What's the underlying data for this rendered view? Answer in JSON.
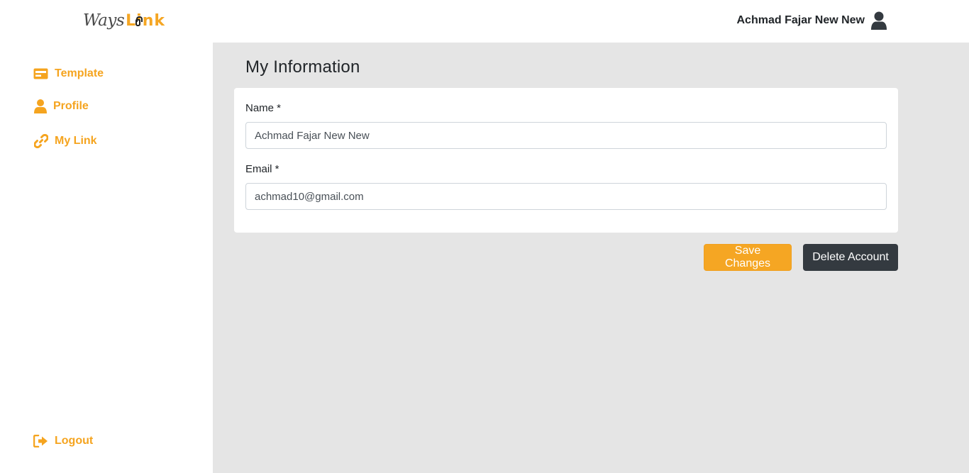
{
  "brand": {
    "part1": "Ways",
    "part2": "Link"
  },
  "header": {
    "user_name": "Achmad Fajar New New"
  },
  "sidebar": {
    "items": [
      {
        "label": "Template",
        "icon": "credit-card-icon"
      },
      {
        "label": "Profile",
        "icon": "user-icon"
      },
      {
        "label": "My Link",
        "icon": "link-icon"
      }
    ],
    "logout": {
      "label": "Logout",
      "icon": "sign-out-icon"
    }
  },
  "main": {
    "title": "My Information",
    "form": {
      "name_label": "Name *",
      "name_value": "Achmad Fajar New New",
      "email_label": "Email *",
      "email_value": "achmad10@gmail.com"
    },
    "buttons": {
      "save": "Save Changes",
      "delete": "Delete Account"
    }
  },
  "colors": {
    "accent": "#f5a623",
    "dark": "#343a40",
    "content_bg": "#e5e5e5"
  }
}
